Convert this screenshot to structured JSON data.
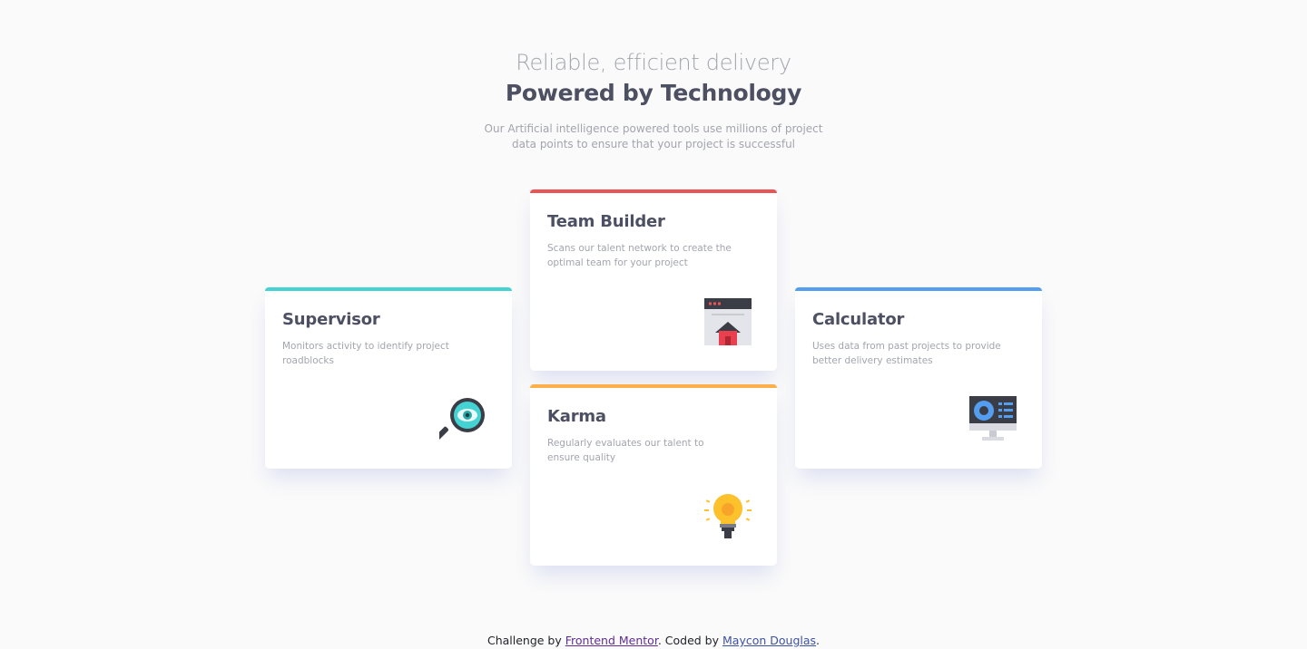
{
  "header": {
    "subtitle": "Reliable, efficient delivery",
    "title": "Powered by Technology",
    "intro": "Our Artificial intelligence powered tools use millions of project data points to ensure that your project is successful"
  },
  "cards": [
    {
      "title": "Supervisor",
      "description": "Monitors activity to identify project roadblocks",
      "accent_color": "#44d3d2",
      "icon": "magnifier-eye-icon"
    },
    {
      "title": "Team Builder",
      "description": "Scans our talent network to create the optimal team for your project",
      "accent_color": "#ea5454",
      "icon": "browser-house-icon"
    },
    {
      "title": "Karma",
      "description": "Regularly evaluates our talent to ensure quality",
      "accent_color": "#fcaf4a",
      "icon": "lightbulb-icon"
    },
    {
      "title": "Calculator",
      "description": "Uses data from past projects to provide better delivery estimates",
      "accent_color": "#549ef2",
      "icon": "monitor-chart-icon"
    }
  ],
  "footer": {
    "prefix": "Challenge by ",
    "link1": "Frontend Mentor",
    "middle": ". Coded by ",
    "link2": "Maycon Douglas",
    "suffix": "."
  }
}
